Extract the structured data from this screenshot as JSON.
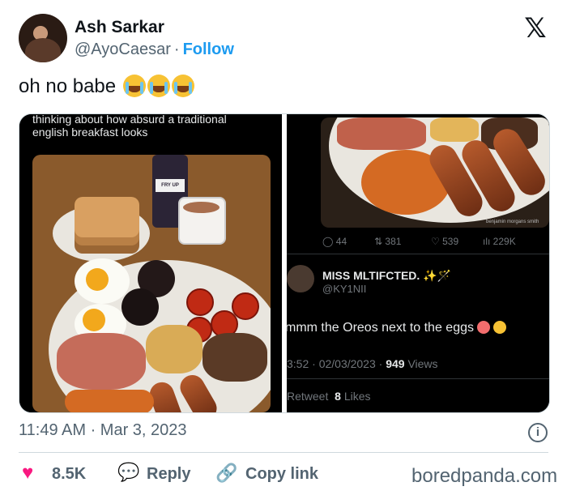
{
  "author": {
    "name": "Ash Sarkar",
    "handle": "@AyoCaesar",
    "separator": "·",
    "follow_label": "Follow"
  },
  "brand": {
    "x_logo": "𝕏"
  },
  "tweet": {
    "text": "oh no babe"
  },
  "media": {
    "left": {
      "line1": "thinking about how absurd a traditional",
      "line2": "english breakfast looks",
      "mug_text": "FRY UP POLICE"
    },
    "right": {
      "photo_credit": "benjamin morgans smith",
      "stats": {
        "replies": "44",
        "retweets": "381",
        "likes": "539",
        "views": "229K"
      },
      "reply": {
        "name": "MISS MLTIFCTED.",
        "handle": "@KY1NII",
        "text": "mmm the Oreos next to the eggs",
        "time": "3:52 · 02/03/2023 ·",
        "views_count": "949",
        "views_label": "Views",
        "retweet_label": "Retweet",
        "likes_count": "8",
        "likes_label": "Likes"
      }
    }
  },
  "meta": {
    "timestamp": "11:49 AM · Mar 3, 2023"
  },
  "actions": {
    "likes": "8.5K",
    "reply_label": "Reply",
    "copy_label": "Copy link"
  },
  "watermark": "boredpanda.com",
  "colors": {
    "accent": "#1d9bf0",
    "heart": "#f91880",
    "text_secondary": "#536471"
  }
}
